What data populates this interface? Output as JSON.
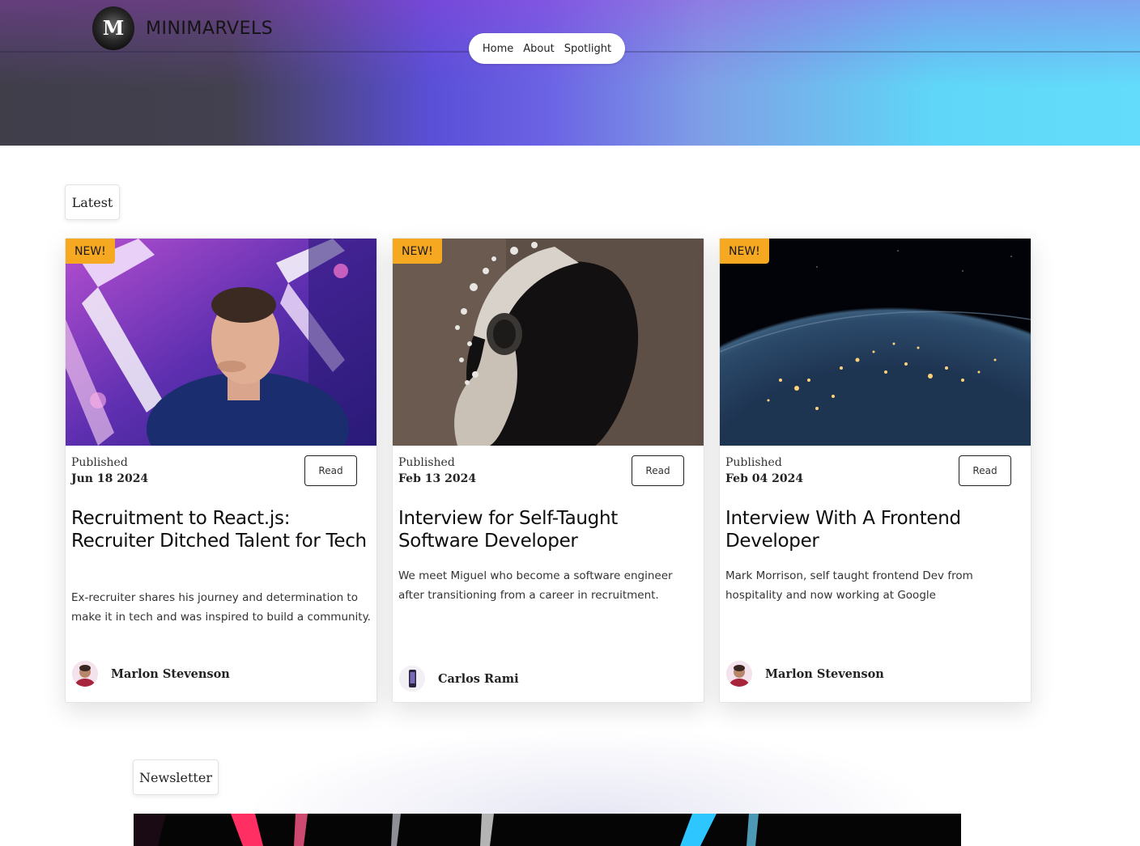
{
  "header": {
    "logo_letter": "M",
    "brand": "MINIMARVELS",
    "nav": [
      "Home",
      "About",
      "Spotlight"
    ]
  },
  "sections": {
    "latest": "Latest",
    "newsletter": "Newsletter"
  },
  "cards": [
    {
      "badge": "NEW!",
      "published_label": "Published",
      "date": "Jun 18 2024",
      "read_label": "Read",
      "title": "Recruitment to React.js: Recruiter Ditched Talent for Tech",
      "description": "Ex-recruiter shares his journey and determination to make it in tech and was inspired to build a community.",
      "author": "Marlon Stevenson"
    },
    {
      "badge": "NEW!",
      "published_label": "Published",
      "date": "Feb 13 2024",
      "read_label": "Read",
      "title": "Interview for Self-Taught Software Developer",
      "description": "We meet Miguel who become a software engineer after transitioning from a career in recruitment.",
      "author": "Carlos Rami"
    },
    {
      "badge": "NEW!",
      "published_label": "Published",
      "date": "Feb 04 2024",
      "read_label": "Read",
      "title": "Interview With A Frontend Developer",
      "description": "Mark Morrison, self taught frontend Dev from hospitality and now working at Google",
      "author": "Marlon Stevenson"
    }
  ]
}
